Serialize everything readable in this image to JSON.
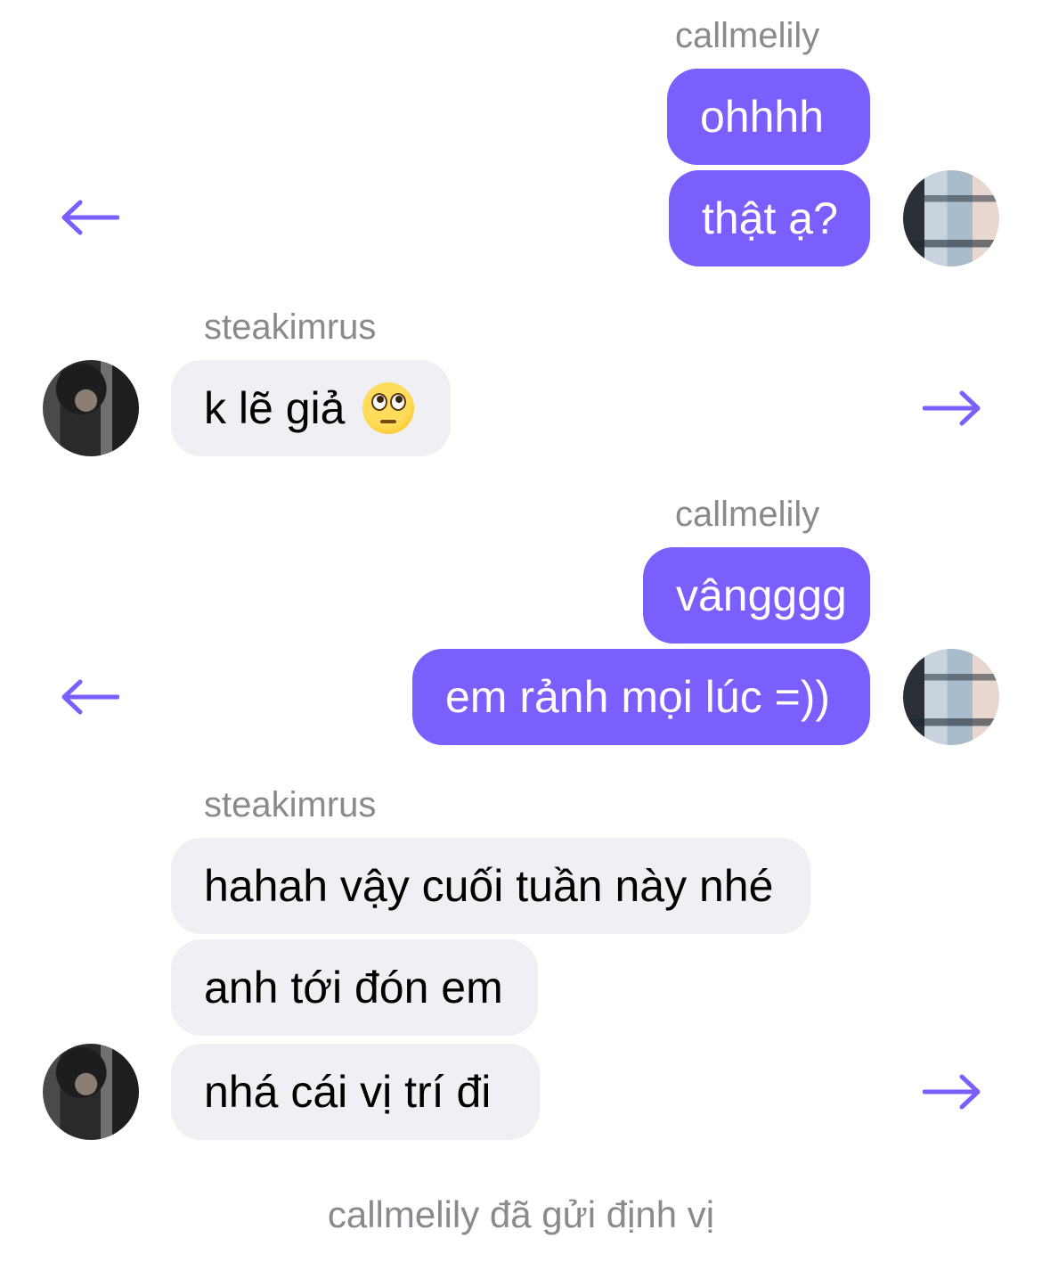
{
  "colors": {
    "outgoing_bubble": "#7b5ffc",
    "incoming_bubble": "#efeff4",
    "arrow": "#7b5ffc",
    "sender_text": "#8a8a8e"
  },
  "groups": [
    {
      "direction": "outgoing",
      "sender": "callmelily",
      "messages": [
        "ohhhh",
        "thật ạ?"
      ],
      "nav_icon": "arrow-left-icon"
    },
    {
      "direction": "incoming",
      "sender": "steakimrus",
      "messages": [
        "k lẽ giả"
      ],
      "emoji": "face-with-rolling-eyes-emoji",
      "nav_icon": "arrow-right-icon"
    },
    {
      "direction": "outgoing",
      "sender": "callmelily",
      "messages": [
        "vângggg",
        "em rảnh mọi lúc =))"
      ],
      "nav_icon": "arrow-left-icon"
    },
    {
      "direction": "incoming",
      "sender": "steakimrus",
      "messages": [
        "hahah vậy cuối tuần này nhé",
        "anh tới đón em",
        "nhá cái vị trí đi"
      ],
      "nav_icon": "arrow-right-icon"
    }
  ],
  "footer": "callmelily đã gửi định vị"
}
